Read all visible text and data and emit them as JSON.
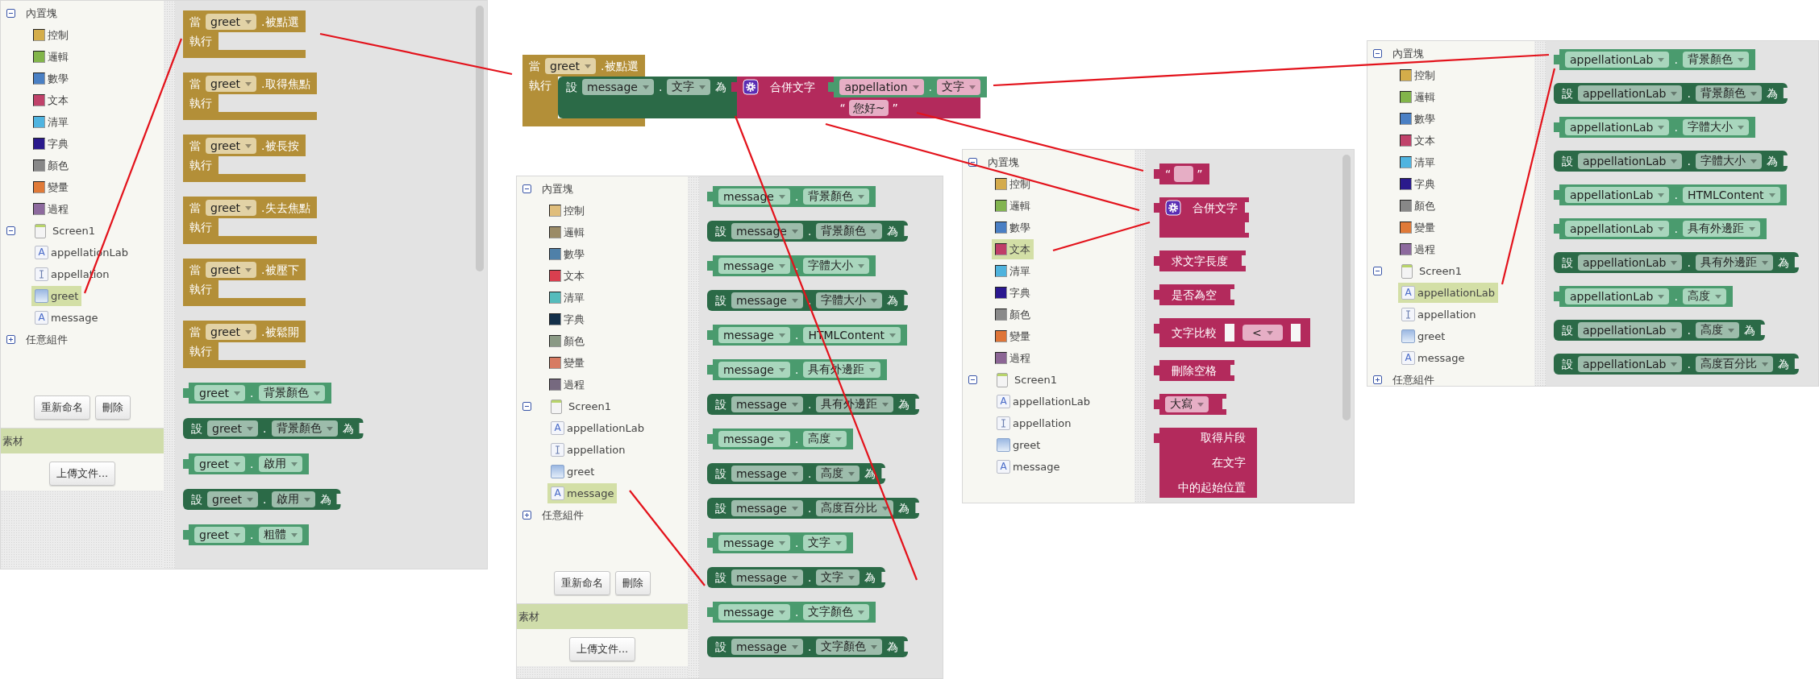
{
  "screenshots": [
    {
      "kind": "editor",
      "sidebar": {
        "builtin": {
          "label": "內置塊",
          "expanded": true,
          "items": [
            {
              "label": "控制",
              "color": "#d4ad4a",
              "selected": false
            },
            {
              "label": "邏輯",
              "color": "#82b54a",
              "selected": false
            },
            {
              "label": "數學",
              "color": "#4a80c4",
              "selected": false
            },
            {
              "label": "文本",
              "color": "#c0426a",
              "selected": false
            },
            {
              "label": "清單",
              "color": "#4fb4e0",
              "selected": false
            },
            {
              "label": "字典",
              "color": "#2a1a8c",
              "selected": false
            },
            {
              "label": "顏色",
              "color": "#888888",
              "selected": false
            },
            {
              "label": "變量",
              "color": "#e07a38",
              "selected": false
            },
            {
              "label": "過程",
              "color": "#8d6a9e",
              "selected": false
            }
          ]
        },
        "screen": {
          "label": "Screen1",
          "expanded": true,
          "components": [
            {
              "label": "appellationLab",
              "kind": "label",
              "icon_text": "A",
              "selected": false
            },
            {
              "label": "appellation",
              "kind": "textbox",
              "selected": false
            },
            {
              "label": "greet",
              "kind": "button",
              "selected": true
            },
            {
              "label": "message",
              "kind": "label",
              "icon_text": "A",
              "selected": false
            }
          ]
        },
        "any": {
          "label": "任意組件",
          "expanded": false
        },
        "buttons": [
          "重新命名",
          "刪除"
        ],
        "media": {
          "title": "素材",
          "button": "上傳文件..."
        }
      },
      "workspace": {
        "blocks": [
          {
            "kind": "event",
            "when": "當",
            "component": "greet",
            "event": ".被點選",
            "do": "執行"
          },
          {
            "kind": "event",
            "when": "當",
            "component": "greet",
            "event": ".取得焦點",
            "do": "執行"
          },
          {
            "kind": "event",
            "when": "當",
            "component": "greet",
            "event": ".被長按",
            "do": "執行"
          },
          {
            "kind": "event",
            "when": "當",
            "component": "greet",
            "event": ".失去焦點",
            "do": "執行"
          },
          {
            "kind": "event",
            "when": "當",
            "component": "greet",
            "event": ".被壓下",
            "do": "執行"
          },
          {
            "kind": "event",
            "when": "當",
            "component": "greet",
            "event": ".被鬆開",
            "do": "執行"
          },
          {
            "kind": "getter",
            "component": "greet",
            "dot": ".",
            "property": "背景顏色"
          },
          {
            "kind": "setter",
            "set": "設",
            "component": "greet",
            "dot": ".",
            "property": "背景顏色",
            "to": "為"
          },
          {
            "kind": "getter",
            "component": "greet",
            "dot": ".",
            "property": "啟用"
          },
          {
            "kind": "setter",
            "set": "設",
            "component": "greet",
            "dot": ".",
            "property": "啟用",
            "to": "為"
          },
          {
            "kind": "getter",
            "component": "greet",
            "dot": ".",
            "property": "粗體"
          }
        ]
      }
    },
    {
      "kind": "block_group",
      "block": {
        "kind": "event",
        "when": "當",
        "component": "greet",
        "event": ".被點選",
        "do": "執行",
        "body": {
          "kind": "setter",
          "set": "設",
          "component": "message",
          "dot": ".",
          "property": "文字",
          "to": "為",
          "value": {
            "kind": "join",
            "label": "合併文字",
            "inputs": [
              {
                "kind": "getter",
                "component": "appellation",
                "dot": ".",
                "property": "文字"
              },
              {
                "kind": "literal",
                "open_quote": "“",
                "value": "您好~",
                "close_quote": "”"
              }
            ]
          }
        }
      }
    },
    {
      "kind": "editor",
      "sidebar": {
        "builtin": {
          "label": "內置塊",
          "expanded": true,
          "items": [
            {
              "label": "控制",
              "color": "#e0be7c",
              "selected": false
            },
            {
              "label": "邏輯",
              "color": "#9b8b66",
              "selected": false
            },
            {
              "label": "數學",
              "color": "#4f80a8",
              "selected": false
            },
            {
              "label": "文本",
              "color": "#d83f4f",
              "selected": false
            },
            {
              "label": "清單",
              "color": "#55bcbc",
              "selected": false
            },
            {
              "label": "字典",
              "color": "#13304a",
              "selected": false
            },
            {
              "label": "顏色",
              "color": "#8a9a85",
              "selected": false
            },
            {
              "label": "變量",
              "color": "#d77b62",
              "selected": false
            },
            {
              "label": "過程",
              "color": "#76697f",
              "selected": false
            }
          ]
        },
        "screen": {
          "label": "Screen1",
          "expanded": true,
          "components": [
            {
              "label": "appellationLab",
              "kind": "label",
              "icon_text": "A",
              "selected": false
            },
            {
              "label": "appellation",
              "kind": "textbox",
              "selected": false
            },
            {
              "label": "greet",
              "kind": "button",
              "selected": false
            },
            {
              "label": "message",
              "kind": "label",
              "icon_text": "A",
              "selected": true
            }
          ]
        },
        "any": {
          "label": "任意組件",
          "expanded": false
        },
        "buttons": [
          "重新命名",
          "刪除"
        ],
        "media": {
          "title": "素材",
          "button": "上傳文件..."
        }
      },
      "workspace": {
        "blocks": [
          {
            "kind": "getter",
            "component": "message",
            "dot": ".",
            "property": "背景顏色"
          },
          {
            "kind": "setter",
            "set": "設",
            "component": "message",
            "dot": ".",
            "property": "背景顏色",
            "to": "為"
          },
          {
            "kind": "getter",
            "component": "message",
            "dot": ".",
            "property": "字體大小"
          },
          {
            "kind": "setter",
            "set": "設",
            "component": "message",
            "dot": ".",
            "property": "字體大小",
            "to": "為"
          },
          {
            "kind": "getter",
            "component": "message",
            "dot": ".",
            "property": "HTMLContent"
          },
          {
            "kind": "getter",
            "component": "message",
            "dot": ".",
            "property": "具有外邊距"
          },
          {
            "kind": "setter",
            "set": "設",
            "component": "message",
            "dot": ".",
            "property": "具有外邊距",
            "to": "為"
          },
          {
            "kind": "getter",
            "component": "message",
            "dot": ".",
            "property": "高度"
          },
          {
            "kind": "setter",
            "set": "設",
            "component": "message",
            "dot": ".",
            "property": "高度",
            "to": "為"
          },
          {
            "kind": "setter",
            "set": "設",
            "component": "message",
            "dot": ".",
            "property": "高度百分比",
            "to": "為"
          },
          {
            "kind": "getter",
            "component": "message",
            "dot": ".",
            "property": "文字"
          },
          {
            "kind": "setter",
            "set": "設",
            "component": "message",
            "dot": ".",
            "property": "文字",
            "to": "為"
          },
          {
            "kind": "getter",
            "component": "message",
            "dot": ".",
            "property": "文字顏色"
          },
          {
            "kind": "setter",
            "set": "設",
            "component": "message",
            "dot": ".",
            "property": "文字顏色",
            "to": "為"
          }
        ]
      }
    },
    {
      "kind": "editor",
      "sidebar": {
        "builtin": {
          "label": "內置塊",
          "expanded": true,
          "items": [
            {
              "label": "控制",
              "color": "#d4ab4c",
              "selected": false
            },
            {
              "label": "邏輯",
              "color": "#82b450",
              "selected": false
            },
            {
              "label": "數學",
              "color": "#4a7fc4",
              "selected": false
            },
            {
              "label": "文本",
              "color": "#bf3e68",
              "selected": true
            },
            {
              "label": "清單",
              "color": "#4fb3dd",
              "selected": false
            },
            {
              "label": "字典",
              "color": "#2b1890",
              "selected": false
            },
            {
              "label": "顏色",
              "color": "#8a8a8a",
              "selected": false
            },
            {
              "label": "變量",
              "color": "#df7538",
              "selected": false
            },
            {
              "label": "過程",
              "color": "#8c6695",
              "selected": false
            }
          ]
        },
        "screen": {
          "label": "Screen1",
          "expanded": true,
          "components": [
            {
              "label": "appellationLab",
              "kind": "label",
              "icon_text": "A",
              "selected": false
            },
            {
              "label": "appellation",
              "kind": "textbox",
              "selected": false
            },
            {
              "label": "greet",
              "kind": "button",
              "selected": false
            },
            {
              "label": "message",
              "kind": "label",
              "icon_text": "A",
              "selected": false
            }
          ]
        }
      },
      "workspace": {
        "blocks": [
          {
            "kind": "literal",
            "open_quote": "“",
            "close_quote": "”"
          },
          {
            "kind": "join",
            "label": "合併文字"
          },
          {
            "kind": "call",
            "label": "求文字長度"
          },
          {
            "kind": "call",
            "label": "是否為空"
          },
          {
            "kind": "compare",
            "label": "文字比較",
            "operator": "<"
          },
          {
            "kind": "call",
            "label": "刪除空格"
          },
          {
            "kind": "option",
            "option": "大寫"
          },
          {
            "kind": "multi",
            "lines": [
              "取得片段",
              "在文字",
              "中的起始位置"
            ]
          }
        ]
      }
    },
    {
      "kind": "editor",
      "sidebar": {
        "builtin": {
          "label": "內置塊",
          "expanded": true,
          "items": [
            {
              "label": "控制",
              "color": "#d4ad4a",
              "selected": false
            },
            {
              "label": "邏輯",
              "color": "#82b54a",
              "selected": false
            },
            {
              "label": "數學",
              "color": "#4a80c4",
              "selected": false
            },
            {
              "label": "文本",
              "color": "#c0426a",
              "selected": false
            },
            {
              "label": "清單",
              "color": "#4fb4e0",
              "selected": false
            },
            {
              "label": "字典",
              "color": "#2a1a8c",
              "selected": false
            },
            {
              "label": "顏色",
              "color": "#888888",
              "selected": false
            },
            {
              "label": "變量",
              "color": "#e07a38",
              "selected": false
            },
            {
              "label": "過程",
              "color": "#8d6a9e",
              "selected": false
            }
          ]
        },
        "screen": {
          "label": "Screen1",
          "expanded": true,
          "components": [
            {
              "label": "appellationLab",
              "kind": "label",
              "icon_text": "A",
              "selected": true
            },
            {
              "label": "appellation",
              "kind": "textbox",
              "selected": false
            },
            {
              "label": "greet",
              "kind": "button",
              "selected": false
            },
            {
              "label": "message",
              "kind": "label",
              "icon_text": "A",
              "selected": false
            }
          ]
        },
        "any": {
          "label": "任意組件",
          "expanded": false
        }
      },
      "workspace": {
        "blocks": [
          {
            "kind": "getter",
            "component": "appellationLab",
            "dot": ".",
            "property": "背景顏色"
          },
          {
            "kind": "setter",
            "set": "設",
            "component": "appellationLab",
            "dot": ".",
            "property": "背景顏色",
            "to": "為"
          },
          {
            "kind": "getter",
            "component": "appellationLab",
            "dot": ".",
            "property": "字體大小"
          },
          {
            "kind": "setter",
            "set": "設",
            "component": "appellationLab",
            "dot": ".",
            "property": "字體大小",
            "to": "為"
          },
          {
            "kind": "getter",
            "component": "appellationLab",
            "dot": ".",
            "property": "HTMLContent"
          },
          {
            "kind": "getter",
            "component": "appellationLab",
            "dot": ".",
            "property": "具有外邊距"
          },
          {
            "kind": "setter",
            "set": "設",
            "component": "appellationLab",
            "dot": ".",
            "property": "具有外邊距",
            "to": "為"
          },
          {
            "kind": "getter",
            "component": "appellationLab",
            "dot": ".",
            "property": "高度"
          },
          {
            "kind": "setter",
            "set": "設",
            "component": "appellationLab",
            "dot": ".",
            "property": "高度",
            "to": "為"
          },
          {
            "kind": "setter",
            "set": "設",
            "component": "appellationLab",
            "dot": ".",
            "property": "高度百分比",
            "to": "為"
          }
        ]
      }
    }
  ]
}
